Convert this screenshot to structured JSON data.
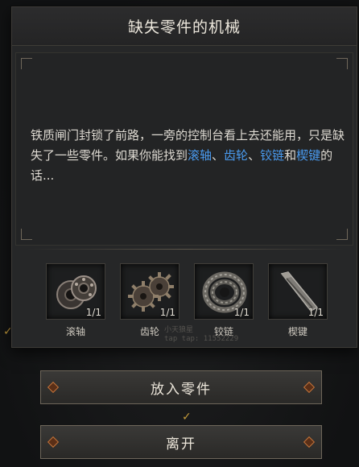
{
  "dialog": {
    "title": "缺失零件的机械",
    "body_parts": [
      {
        "text": "铁质闸门封锁了前路，一旁的控制台看上去还能用，只是缺失了一些零件。如果你能找到",
        "hl": false
      },
      {
        "text": "滚轴",
        "hl": true
      },
      {
        "text": "、",
        "hl": false
      },
      {
        "text": "齿轮",
        "hl": true
      },
      {
        "text": "、",
        "hl": false
      },
      {
        "text": "铰链",
        "hl": true
      },
      {
        "text": "和",
        "hl": false
      },
      {
        "text": "楔键",
        "hl": true
      },
      {
        "text": "的话...",
        "hl": false
      }
    ],
    "highlight_color": "#4a9bf0"
  },
  "parts": [
    {
      "name": "滚轴",
      "count": "1/1",
      "icon": "roller-bearing-icon"
    },
    {
      "name": "齿轮",
      "count": "1/1",
      "icon": "gears-icon"
    },
    {
      "name": "铰链",
      "count": "1/1",
      "icon": "chain-icon"
    },
    {
      "name": "楔键",
      "count": "1/1",
      "icon": "wedge-key-icon"
    }
  ],
  "watermark": {
    "line1": "小天狼星",
    "line2": "tap tap: 11552229"
  },
  "buttons": {
    "place": "放入零件",
    "leave": "离开"
  }
}
